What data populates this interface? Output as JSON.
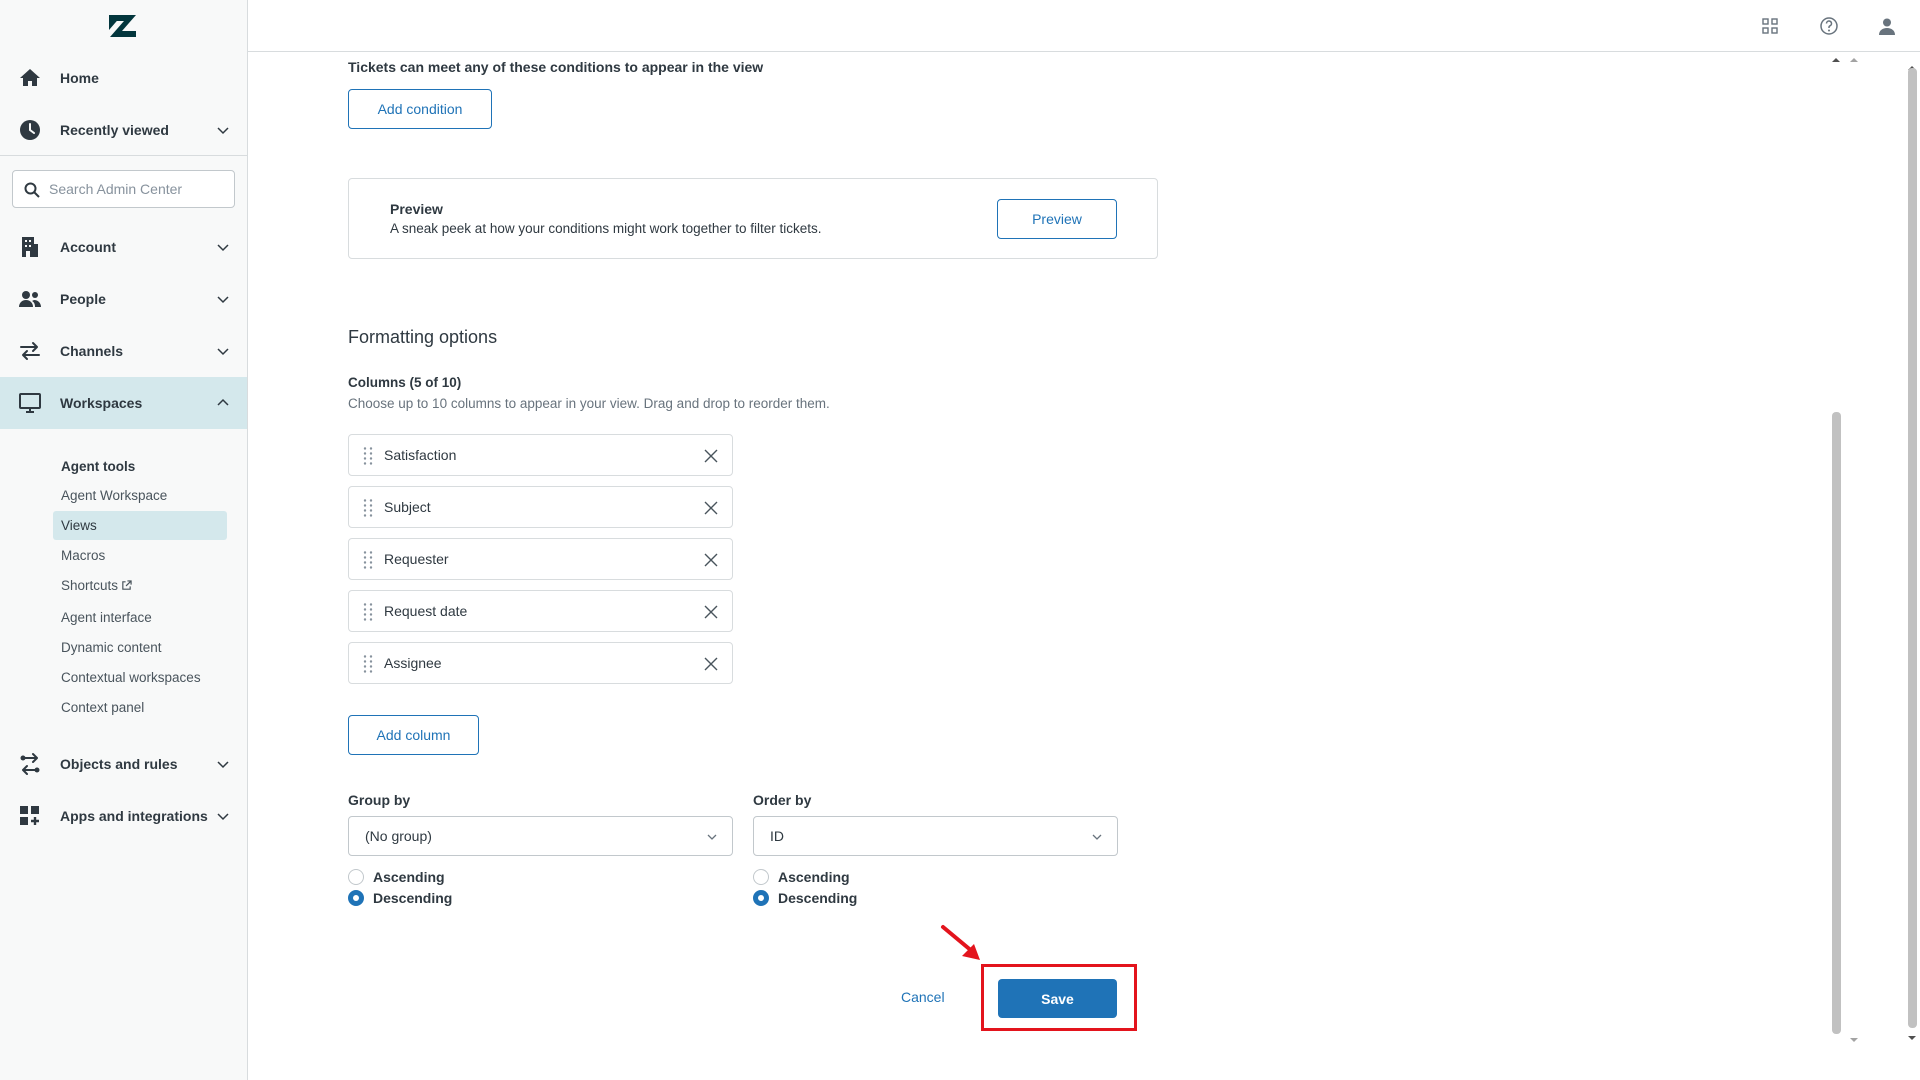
{
  "sidebar": {
    "logo": "zendesk-logo",
    "nav": [
      {
        "label": "Home",
        "icon": "home-icon"
      },
      {
        "label": "Recently viewed",
        "icon": "clock-icon"
      },
      {
        "label": "Account",
        "icon": "building-icon"
      },
      {
        "label": "People",
        "icon": "people-icon"
      },
      {
        "label": "Channels",
        "icon": "arrows-icon"
      },
      {
        "label": "Workspaces",
        "icon": "monitor-icon"
      },
      {
        "label": "Objects and rules",
        "icon": "objects-rules-icon"
      },
      {
        "label": "Apps and integrations",
        "icon": "apps-icon"
      }
    ],
    "search_placeholder": "Search Admin Center",
    "workspaces_section": {
      "heading": "Agent tools",
      "items": [
        {
          "label": "Agent Workspace"
        },
        {
          "label": "Views",
          "active": true
        },
        {
          "label": "Macros"
        },
        {
          "label": "Shortcuts"
        },
        {
          "label": "Agent interface"
        },
        {
          "label": "Dynamic content"
        },
        {
          "label": "Contextual workspaces"
        },
        {
          "label": "Context panel"
        }
      ]
    }
  },
  "header": {
    "icons": [
      "product-tray-icon",
      "help-icon",
      "user-icon"
    ]
  },
  "main": {
    "conditions_text": "Tickets can meet any of these conditions to appear in the view",
    "add_condition_label": "Add condition",
    "preview": {
      "title": "Preview",
      "description": "A sneak peek at how your conditions might work together to filter tickets.",
      "button_label": "Preview"
    },
    "formatting_title": "Formatting options",
    "columns_label": "Columns (5 of 10)",
    "columns_hint": "Choose up to 10 columns to appear in your view. Drag and drop to reorder them.",
    "columns": [
      "Satisfaction",
      "Subject",
      "Requester",
      "Request date",
      "Assignee"
    ],
    "add_column_label": "Add column",
    "group_by": {
      "label": "Group by",
      "value": "(No group)",
      "options": [
        {
          "label": "Ascending",
          "checked": false
        },
        {
          "label": "Descending",
          "checked": true
        }
      ]
    },
    "order_by": {
      "label": "Order by",
      "value": "ID",
      "options": [
        {
          "label": "Ascending",
          "checked": false
        },
        {
          "label": "Descending",
          "checked": true
        }
      ]
    },
    "cancel_label": "Cancel",
    "save_label": "Save"
  },
  "colors": {
    "accent": "#1f73b7",
    "active_nav_bg": "#d4e8ec",
    "highlight": "#e3141d"
  }
}
